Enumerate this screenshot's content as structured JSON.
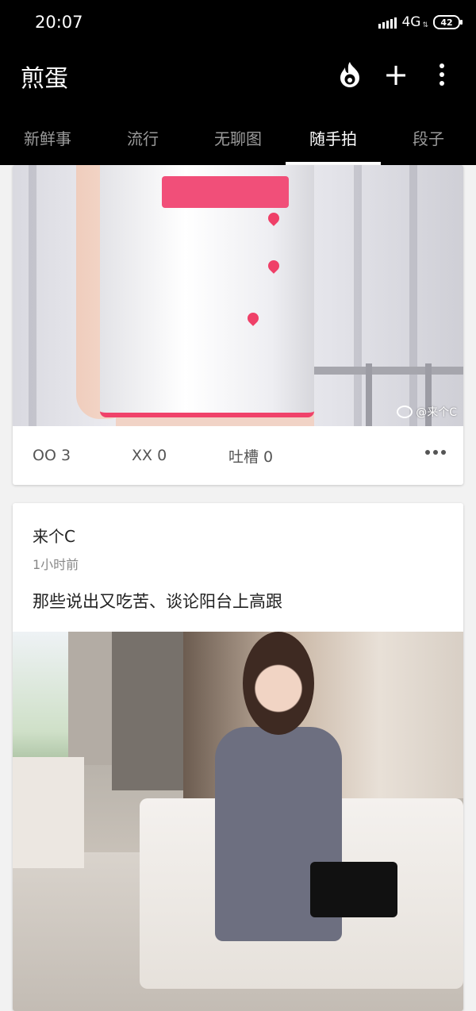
{
  "status": {
    "time": "20:07",
    "network": "4G",
    "network_sub": "⇅",
    "battery": "42"
  },
  "app": {
    "title": "煎蛋"
  },
  "tabs": [
    {
      "label": "新鲜事",
      "active": false
    },
    {
      "label": "流行",
      "active": false
    },
    {
      "label": "无聊图",
      "active": false
    },
    {
      "label": "随手拍",
      "active": true
    },
    {
      "label": "段子",
      "active": false
    }
  ],
  "feed": {
    "card1": {
      "watermark": "@来个C",
      "oo": "OO 3",
      "xx": "XX 0",
      "comment": "吐槽 0"
    },
    "card2": {
      "author": "来个C",
      "time": "1小时前",
      "text": "那些说出又吃苦、谈论阳台上高跟"
    }
  },
  "icons": {
    "hot": "flame-icon",
    "add": "plus-icon",
    "menu": "more-vertical-icon"
  }
}
